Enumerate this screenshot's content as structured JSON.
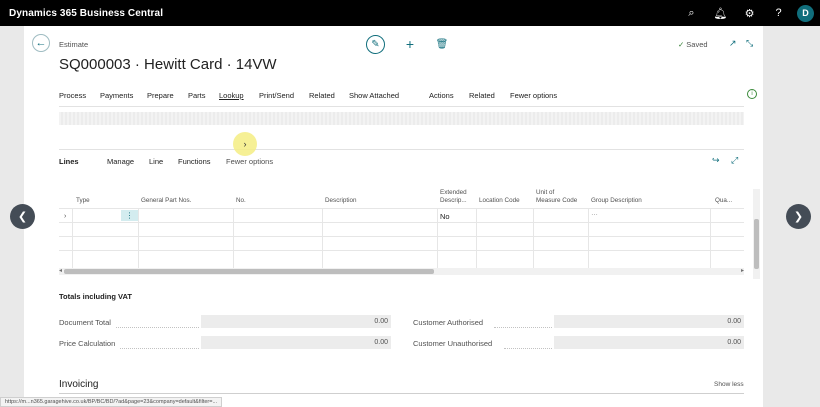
{
  "app": {
    "title": "Dynamics 365 Business Central",
    "user_initial": "D",
    "icons": [
      "search-icon",
      "bell-icon",
      "gear-icon",
      "help-icon"
    ]
  },
  "header": {
    "caption": "Estimate",
    "title": "SQ000003 · Hewitt Card · 14VW",
    "saved": "Saved"
  },
  "actions": [
    "Process",
    "Payments",
    "Prepare",
    "Parts",
    "Lookup",
    "Print/Send",
    "Related",
    "Show Attached",
    "Actions",
    "Related",
    "Fewer options"
  ],
  "lines": {
    "title": "Lines",
    "menu": [
      "Manage",
      "Line",
      "Functions"
    ],
    "fewer": "Fewer options",
    "columns": {
      "type": "Type",
      "general_part_nos": "General Part Nos.",
      "no": "No.",
      "description": "Description",
      "extended_desc_1": "Extended",
      "extended_desc_2": "Descrip...",
      "location_code": "Location Code",
      "uom_1": "Unit of",
      "uom_2": "Measure Code",
      "group_description": "Group Description",
      "qua": "Qua..."
    },
    "row": {
      "extended_desc_value": "No"
    }
  },
  "totals": {
    "title": "Totals including VAT",
    "document_total_label": "Document Total",
    "document_total_value": "0.00",
    "price_calculation_label": "Price Calculation",
    "price_calculation_value": "0.00",
    "customer_authorised_label": "Customer Authorised",
    "customer_authorised_value": "0.00",
    "customer_unauthorised_label": "Customer Unauthorised",
    "customer_unauthorised_value": "0.00"
  },
  "invoicing": {
    "title": "Invoicing",
    "show_less": "Show less"
  },
  "status_url": "https://m...n365.garagehive.co.uk/BP/BC/BD/?ad&page=23&company=default&filter=..."
}
